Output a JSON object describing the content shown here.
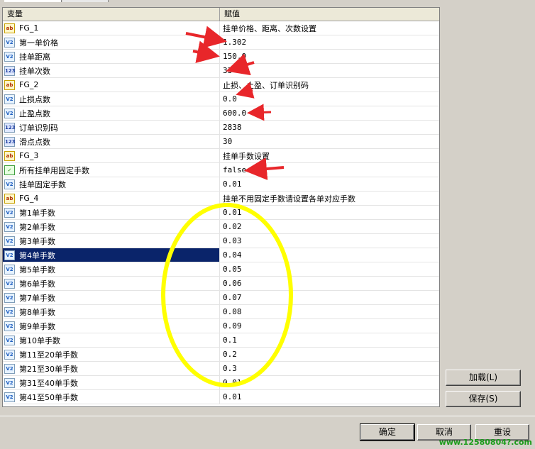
{
  "grid": {
    "header": {
      "name": "变量",
      "value": "赋值"
    },
    "rows": [
      {
        "icon": "ab",
        "name": "FG_1",
        "value": "挂单价格、距离、次数设置"
      },
      {
        "icon": "v2",
        "name": "第一单价格",
        "value": "1.302"
      },
      {
        "icon": "v2",
        "name": "挂单距离",
        "value": "150.0"
      },
      {
        "icon": "123",
        "name": "挂单次数",
        "value": "33"
      },
      {
        "icon": "ab",
        "name": "FG_2",
        "value": "止损、止盈、订单识别码"
      },
      {
        "icon": "v2",
        "name": "止损点数",
        "value": "0.0"
      },
      {
        "icon": "v2",
        "name": "止盈点数",
        "value": "600.0"
      },
      {
        "icon": "123",
        "name": "订单识别码",
        "value": "2838"
      },
      {
        "icon": "123",
        "name": "滑点点数",
        "value": "30"
      },
      {
        "icon": "ab",
        "name": "FG_3",
        "value": "挂单手数设置"
      },
      {
        "icon": "bool",
        "name": "所有挂单用固定手数",
        "value": "false"
      },
      {
        "icon": "v2",
        "name": "挂单固定手数",
        "value": "0.01"
      },
      {
        "icon": "ab",
        "name": "FG_4",
        "value": "挂单不用固定手数请设置各单对应手数"
      },
      {
        "icon": "v2",
        "name": "第1单手数",
        "value": "0.01"
      },
      {
        "icon": "v2",
        "name": "第2单手数",
        "value": "0.02"
      },
      {
        "icon": "v2",
        "name": "第3单手数",
        "value": "0.03"
      },
      {
        "icon": "v2",
        "name": "第4单手数",
        "value": "0.04",
        "selected": true
      },
      {
        "icon": "v2",
        "name": "第5单手数",
        "value": "0.05"
      },
      {
        "icon": "v2",
        "name": "第6单手数",
        "value": "0.06"
      },
      {
        "icon": "v2",
        "name": "第7单手数",
        "value": "0.07"
      },
      {
        "icon": "v2",
        "name": "第8单手数",
        "value": "0.08"
      },
      {
        "icon": "v2",
        "name": "第9单手数",
        "value": "0.09"
      },
      {
        "icon": "v2",
        "name": "第10单手数",
        "value": "0.1"
      },
      {
        "icon": "v2",
        "name": "第11至20单手数",
        "value": "0.2"
      },
      {
        "icon": "v2",
        "name": "第21至30单手数",
        "value": "0.3"
      },
      {
        "icon": "v2",
        "name": "第31至40单手数",
        "value": "0.01"
      },
      {
        "icon": "v2",
        "name": "第41至50单手数",
        "value": "0.01"
      }
    ]
  },
  "side_buttons": {
    "load": "加载(L)",
    "save": "保存(S)"
  },
  "bottom_buttons": {
    "ok": "确定",
    "cancel": "取消",
    "reset": "重设"
  },
  "watermark": "www.12580804?.com",
  "colors": {
    "selection": "#0a246a",
    "annotation_arrow": "#e8262a",
    "annotation_ellipse": "#ffff00",
    "watermark": "#1a9c1a"
  }
}
